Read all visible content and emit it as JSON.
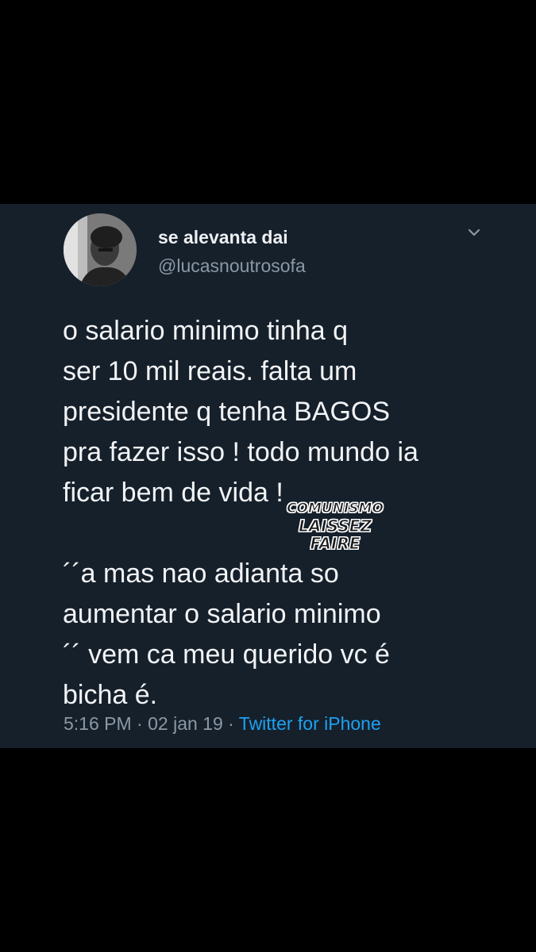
{
  "tweet": {
    "display_name": "se alevanta dai",
    "handle": "@lucasnoutrosofa",
    "menu_icon": "chevron-down-icon",
    "text_lines": [
      "o salario minimo tinha q",
      "ser 10 mil reais. falta um",
      "presidente q tenha BAGOS",
      "pra fazer isso ! todo mundo ia",
      "ficar bem de vida !",
      "´´a mas nao adianta so",
      "aumentar o salario minimo",
      "´´ vem ca meu querido vc é",
      "bicha é."
    ],
    "time": "5:16 PM",
    "separator": "·",
    "date": "02 jan 19",
    "source": "Twitter for iPhone",
    "source_color": "#1da1f2"
  },
  "watermark": {
    "line1": "COMUNISMO",
    "line2": "LAISSEZ FAIRE"
  },
  "colors": {
    "page_background": "#000000",
    "card_background": "#15202b",
    "secondary_text": "#8b98a5"
  }
}
